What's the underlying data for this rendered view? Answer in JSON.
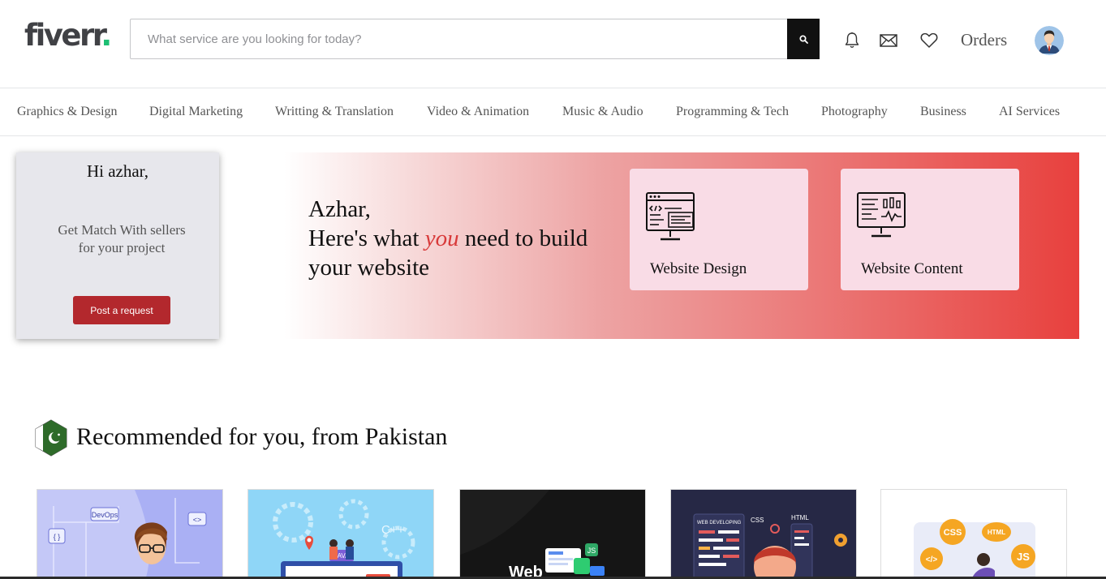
{
  "header": {
    "logo_text": "fiverr",
    "logo_dot": ".",
    "search_placeholder": "What service are you looking for today?",
    "orders_label": "Orders",
    "icons": [
      "search-icon",
      "bell-icon",
      "mail-icon",
      "heart-icon",
      "user-avatar"
    ]
  },
  "categories": [
    "Graphics & Design",
    "Digital Marketing",
    "Writting & Translation",
    "Video & Animation",
    "Music & Audio",
    "Programming & Tech",
    "Photography",
    "Business",
    "AI Services"
  ],
  "hello_card": {
    "greeting": "Hi azhar,",
    "text": "Get Match With sellers for your project",
    "button_label": "Post a request"
  },
  "banner": {
    "line1": "Azhar,",
    "line2_before": "Here's what ",
    "line2_emphasis": "you",
    "line2_after": " need to build",
    "line3": "your website",
    "cards": [
      {
        "label": "Website Design",
        "icon": "code-monitor-icon"
      },
      {
        "label": "Website Content",
        "icon": "analytics-monitor-icon"
      }
    ]
  },
  "recommended": {
    "title": "Recommended for you, from Pakistan",
    "flag_icon": "pakistan-flag-icon",
    "gig_thumbnails": [
      {
        "text": "DevOps",
        "icon": "developer-illustration"
      },
      {
        "text": "C++",
        "icon": "java-developers-illustration"
      },
      {
        "text": "Web",
        "icon": "web-development-illustration"
      },
      {
        "text": "WEB DEVELOPING",
        "icon": "web-developer-illustration"
      },
      {
        "text": "CSS",
        "icon": "css-html-js-illustration"
      }
    ]
  },
  "colors": {
    "brand_green": "#1dbf73",
    "logo_dark": "#404145",
    "post_button": "#b3282d",
    "banner_red": "#e8403d",
    "card_pink": "#f9dce6",
    "emphasis_red": "#d83a3a"
  }
}
